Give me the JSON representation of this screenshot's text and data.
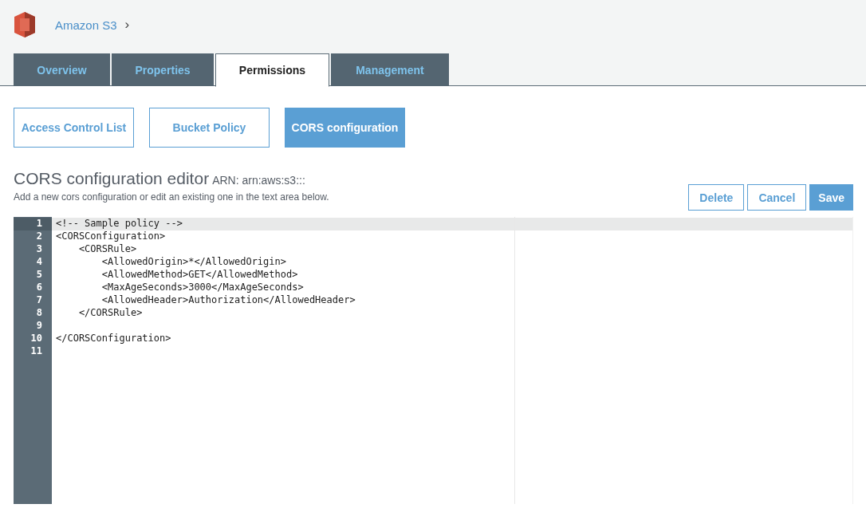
{
  "breadcrumb": {
    "service": "Amazon S3",
    "separator": "›"
  },
  "tabs": [
    {
      "label": "Overview",
      "selected": false
    },
    {
      "label": "Properties",
      "selected": false
    },
    {
      "label": "Permissions",
      "selected": true
    },
    {
      "label": "Management",
      "selected": false
    }
  ],
  "sub_tabs": [
    {
      "label": "Access Control List",
      "selected": false
    },
    {
      "label": "Bucket Policy",
      "selected": false
    },
    {
      "label": "CORS configuration",
      "selected": true
    }
  ],
  "editor_header": {
    "title": "CORS configuration editor",
    "arn": "ARN: arn:aws:s3:::",
    "description": "Add a new cors configuration or edit an existing one in the text area below."
  },
  "buttons": [
    {
      "label": "Delete",
      "kind": "secondary"
    },
    {
      "label": "Cancel",
      "kind": "secondary"
    },
    {
      "label": "Save",
      "kind": "primary"
    }
  ],
  "code_lines": [
    {
      "number": "1",
      "text": "<!-- Sample policy -->",
      "active": true
    },
    {
      "number": "2",
      "text": "<CORSConfiguration>",
      "active": false
    },
    {
      "number": "3",
      "text": "    <CORSRule>",
      "active": false
    },
    {
      "number": "4",
      "text": "        <AllowedOrigin>*</AllowedOrigin>",
      "active": false
    },
    {
      "number": "5",
      "text": "        <AllowedMethod>GET</AllowedMethod>",
      "active": false
    },
    {
      "number": "6",
      "text": "        <MaxAgeSeconds>3000</MaxAgeSeconds>",
      "active": false
    },
    {
      "number": "7",
      "text": "        <AllowedHeader>Authorization</AllowedHeader>",
      "active": false
    },
    {
      "number": "8",
      "text": "    </CORSRule>",
      "active": false
    },
    {
      "number": "9",
      "active": false
    },
    {
      "number": "10",
      "text": "</CORSConfiguration>",
      "active": false
    },
    {
      "number": "11",
      "active": false
    }
  ]
}
